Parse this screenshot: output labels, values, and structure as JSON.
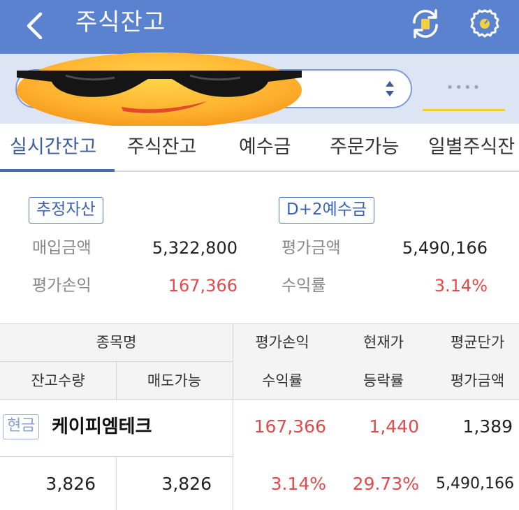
{
  "header": {
    "title": "주식잔고",
    "background": "#5b82cf",
    "icons": {
      "back": "chevron-left-icon",
      "refresh": "refresh-icon",
      "settings": "settings-gear-icon"
    }
  },
  "account": {
    "password_mask": "••••",
    "cover": "sunglasses-emoji"
  },
  "tabs": [
    "실시간잔고",
    "주식잔고",
    "예수금",
    "주문가능",
    "일별주식잔"
  ],
  "active_tab": 0,
  "summary": {
    "left_badge": "추정자산",
    "right_badge": "D+2예수금",
    "purchase_label": "매입금액",
    "purchase_value": "5,322,800",
    "eval_label": "평가금액",
    "eval_value": "5,490,166",
    "pnl_label": "평가손익",
    "pnl_value": "167,366",
    "return_label": "수익률",
    "return_value": "3.14%"
  },
  "table": {
    "headers": {
      "name": "종목명",
      "holding_qty": "잔고수량",
      "sellable": "매도가능",
      "pnl": "평가손익",
      "return_rate": "수익률",
      "current_price": "현재가",
      "change_rate": "등락률",
      "avg_price": "평균단가",
      "eval_amount": "평가금액"
    },
    "rows": [
      {
        "type_badge": "현금",
        "name": "케이피엠테크",
        "pnl": "167,366",
        "current_price": "1,440",
        "avg_price": "1,389",
        "holding_qty": "3,826",
        "sellable": "3,826",
        "return_rate": "3.14%",
        "change_rate": "29.73%",
        "eval_amount": "5,490,166"
      }
    ]
  },
  "colors": {
    "positive": "#e04b4b",
    "accent": "#4a6bb0",
    "password_underline": "#e8cf2a"
  }
}
